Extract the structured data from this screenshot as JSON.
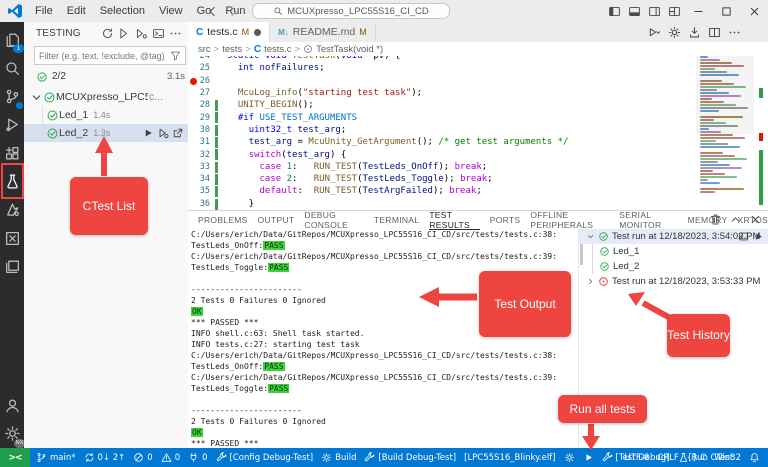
{
  "colors": {
    "status_bar": "#0078d4",
    "remote_green": "#1f9e4e",
    "pass_badge": "#3fd23f",
    "annotation_red": "#ee4540"
  },
  "titlebar": {
    "menus": [
      "File",
      "Edit",
      "Selection",
      "View",
      "Go",
      "Run",
      "···"
    ],
    "search_value": "MCUXpresso_LPC55S16_CI_CD",
    "layout_icons": [
      "toggle-sidebar",
      "toggle-panel",
      "toggle-secondary-sidebar",
      "customize-layout"
    ],
    "window_controls": [
      "minimize",
      "maximize",
      "close"
    ]
  },
  "activity_bar": {
    "items": [
      {
        "icon": "files",
        "badge": "1"
      },
      {
        "icon": "search"
      },
      {
        "icon": "source-control",
        "dot": true
      },
      {
        "icon": "run-debug"
      },
      {
        "icon": "extensions"
      },
      {
        "icon": "testing",
        "active": true
      },
      {
        "icon": "mcuxpresso"
      },
      {
        "icon": "x-square"
      },
      {
        "icon": "library"
      }
    ],
    "bottom_items": [
      {
        "icon": "account"
      },
      {
        "icon": "settings",
        "badge": "NX"
      }
    ]
  },
  "testing_panel": {
    "title": "TESTING",
    "toolbar_icons": [
      "refresh",
      "run-all",
      "debug-all",
      "terminal",
      "more"
    ],
    "filter_placeholder": "Filter (e.g. text, !exclude, @tag)",
    "summary_count": "2/2",
    "summary_time": "3.1s",
    "tree": [
      {
        "level": 0,
        "chevron": "down",
        "status": "pass",
        "label": "MCUXpresso_LPC55S16_CI_CD",
        "suffix": "c...",
        "selected": false,
        "actions": []
      },
      {
        "level": 1,
        "status": "pass",
        "label": "Led_1",
        "time": "1.4s",
        "selected": false,
        "actions": []
      },
      {
        "level": 1,
        "status": "pass",
        "label": "Led_2",
        "time": "1.3s",
        "selected": true,
        "actions": [
          "play",
          "debug-play",
          "goto"
        ]
      }
    ]
  },
  "editor": {
    "tabs": [
      {
        "label": "tests.c",
        "icon": "c-file",
        "git": "M",
        "dirty": true,
        "active": true
      },
      {
        "label": "README.md",
        "icon": "md-file",
        "git": "M",
        "dirty": false,
        "active": false
      }
    ],
    "breadcrumb": [
      {
        "label": "src"
      },
      {
        "label": "tests"
      },
      {
        "label": "tests.c",
        "icon": "c-file"
      },
      {
        "label": "TestTask(void *)",
        "icon": "symbol-method"
      }
    ],
    "action_icons": [
      "run-dropdown",
      "gear",
      "download",
      "split",
      "more"
    ],
    "code_lines": [
      {
        "n": 24,
        "seg": [
          [
            "kw",
            "static"
          ],
          [
            "pl",
            " "
          ],
          [
            "kw",
            "void"
          ],
          [
            "pl",
            " "
          ],
          [
            "fn",
            "TestTask"
          ],
          [
            "pl",
            "("
          ],
          [
            "kw",
            "void"
          ],
          [
            "pl",
            " *pv) {"
          ]
        ]
      },
      {
        "n": 25,
        "seg": [
          [
            "pl",
            "  "
          ],
          [
            "kw",
            "int"
          ],
          [
            "pl",
            " "
          ],
          [
            "var",
            "nofFailures"
          ],
          [
            "pl",
            ";"
          ]
        ]
      },
      {
        "n": 26,
        "breakpoint": true,
        "seg": []
      },
      {
        "n": 27,
        "seg": [
          [
            "pl",
            "  "
          ],
          [
            "fn",
            "McuLog_info"
          ],
          [
            "pl",
            "("
          ],
          [
            "str",
            "\"starting test task\""
          ],
          [
            "pl",
            ");"
          ]
        ]
      },
      {
        "n": 28,
        "changed": true,
        "seg": [
          [
            "pl",
            "  "
          ],
          [
            "fn",
            "UNITY_BEGIN"
          ],
          [
            "pl",
            "();"
          ]
        ]
      },
      {
        "n": 29,
        "changed": true,
        "seg": [
          [
            "pl",
            "  "
          ],
          [
            "pp",
            "#if"
          ],
          [
            "pl",
            " "
          ],
          [
            "mac",
            "USE_TEST_ARGUMENTS"
          ]
        ]
      },
      {
        "n": 30,
        "changed": true,
        "seg": [
          [
            "pl",
            "    "
          ],
          [
            "kw",
            "uint32_t"
          ],
          [
            "pl",
            " "
          ],
          [
            "var",
            "test_arg"
          ],
          [
            "pl",
            ";"
          ]
        ]
      },
      {
        "n": 31,
        "changed": true,
        "seg": [
          [
            "pl",
            "    "
          ],
          [
            "var",
            "test_arg"
          ],
          [
            "pl",
            " = "
          ],
          [
            "fn",
            "McuUnity_GetArgument"
          ],
          [
            "pl",
            "(); "
          ],
          [
            "cmt",
            "/* get test arguments */"
          ]
        ]
      },
      {
        "n": 32,
        "changed": true,
        "seg": [
          [
            "pl",
            "    "
          ],
          [
            "ctl",
            "switch"
          ],
          [
            "pl",
            "("
          ],
          [
            "var",
            "test_arg"
          ],
          [
            "pl",
            ") {"
          ]
        ]
      },
      {
        "n": 33,
        "changed": true,
        "seg": [
          [
            "pl",
            "      "
          ],
          [
            "ctl",
            "case"
          ],
          [
            "pl",
            " "
          ],
          [
            "num",
            "1"
          ],
          [
            "pl",
            ":   "
          ],
          [
            "fn",
            "RUN_TEST"
          ],
          [
            "pl",
            "("
          ],
          [
            "var",
            "TestLeds_OnOff"
          ],
          [
            "pl",
            "); "
          ],
          [
            "ctl",
            "break"
          ],
          [
            "pl",
            ";"
          ]
        ]
      },
      {
        "n": 34,
        "changed": true,
        "seg": [
          [
            "pl",
            "      "
          ],
          [
            "ctl",
            "case"
          ],
          [
            "pl",
            " "
          ],
          [
            "num",
            "2"
          ],
          [
            "pl",
            ":   "
          ],
          [
            "fn",
            "RUN_TEST"
          ],
          [
            "pl",
            "("
          ],
          [
            "var",
            "TestLeds_Toggle"
          ],
          [
            "pl",
            "); "
          ],
          [
            "ctl",
            "break"
          ],
          [
            "pl",
            ";"
          ]
        ]
      },
      {
        "n": 35,
        "changed": true,
        "seg": [
          [
            "pl",
            "      "
          ],
          [
            "ctl",
            "default"
          ],
          [
            "pl",
            ":  "
          ],
          [
            "fn",
            "RUN_TEST"
          ],
          [
            "pl",
            "("
          ],
          [
            "var",
            "TestArgFailed"
          ],
          [
            "pl",
            "); "
          ],
          [
            "ctl",
            "break"
          ],
          [
            "pl",
            ";"
          ]
        ]
      },
      {
        "n": 36,
        "changed": true,
        "seg": [
          [
            "pl",
            "    }"
          ]
        ]
      }
    ]
  },
  "panel": {
    "tabs": [
      {
        "label": "PROBLEMS"
      },
      {
        "label": "OUTPUT"
      },
      {
        "label": "DEBUG CONSOLE"
      },
      {
        "label": "TERMINAL"
      },
      {
        "label": "TEST RESULTS",
        "active": true
      },
      {
        "label": "PORTS"
      },
      {
        "label": "OFFLINE PERIPHERALS"
      },
      {
        "label": "SERIAL MONITOR"
      },
      {
        "label": "MEMORY"
      },
      {
        "label": "XRTOS"
      }
    ],
    "toolbar_icons": [
      "trash",
      "chevron-up",
      "close"
    ],
    "output_lines": [
      {
        "text": "C:/Users/erich/Data/GitRepos/MCUXpresso_LPC55S16_CI_CD/src/tests/tests.c:38:"
      },
      {
        "text": "TestLeds_OnOff:",
        "badge": "PASS"
      },
      {
        "text": "C:/Users/erich/Data/GitRepos/MCUXpresso_LPC55S16_CI_CD/src/tests/tests.c:39:"
      },
      {
        "text": "TestLeds_Toggle:",
        "badge": "PASS"
      },
      {
        "text": ""
      },
      {
        "text": "-----------------------"
      },
      {
        "text": "2 Tests 0 Failures 0 Ignored"
      },
      {
        "text": "",
        "badge": "OK"
      },
      {
        "text": "*** PASSED ***"
      },
      {
        "text": "INFO  shell.c:63: Shell task started."
      },
      {
        "text": "INFO  tests.c:27: starting test task"
      },
      {
        "text": "C:/Users/erich/Data/GitRepos/MCUXpresso_LPC55S16_CI_CD/src/tests/tests.c:38:"
      },
      {
        "text": "TestLeds_OnOff:",
        "badge": "PASS"
      },
      {
        "text": "C:/Users/erich/Data/GitRepos/MCUXpresso_LPC55S16_CI_CD/src/tests/tests.c:39:"
      },
      {
        "text": "TestLeds_Toggle:",
        "badge": "PASS"
      },
      {
        "text": ""
      },
      {
        "text": "-----------------------"
      },
      {
        "text": "2 Tests 0 Failures 0 Ignored"
      },
      {
        "text": "",
        "badge": "OK"
      },
      {
        "text": "*** PASSED ***"
      }
    ],
    "history_runs": [
      {
        "chevron": "down",
        "status": "pass",
        "label": "Test run at 12/18/2023, 3:54:02 PM",
        "selected": true,
        "actions": [
          "terminal",
          "play"
        ],
        "children": [
          {
            "status": "pass",
            "label": "Led_1"
          },
          {
            "status": "pass",
            "label": "Led_2"
          }
        ]
      },
      {
        "chevron": "right",
        "status": "fail",
        "label": "Test run at 12/18/2023, 3:53:33 PM",
        "selected": false,
        "actions": [],
        "children": []
      }
    ]
  },
  "status_bar": {
    "remote_glyph": "><",
    "left": [
      {
        "icon": "branch",
        "text": "main*"
      },
      {
        "icon": "sync",
        "text": "0↓ 2↑"
      },
      {
        "icon": "error",
        "text": "0"
      },
      {
        "icon": "warning",
        "text": "0"
      },
      {
        "icon": "plug",
        "text": "0"
      },
      {
        "icon": "tools",
        "text": "[Config Debug-Test]"
      },
      {
        "icon": "gear",
        "text": "Build"
      },
      {
        "icon": "tools",
        "text": "[Build Debug-Test]"
      },
      {
        "text": "[LPC55S16_Blinky.elf]"
      },
      {
        "icon": "gear"
      },
      {
        "icon": "play"
      },
      {
        "icon": "tools",
        "text": "[Test Debug]"
      },
      {
        "icon": "beaker",
        "text": "Run CTest"
      }
    ],
    "right": [
      {
        "text": "UTF-8"
      },
      {
        "text": "CRLF"
      },
      {
        "text": "{} C"
      },
      {
        "text": "Win32"
      },
      {
        "icon": "bell"
      }
    ]
  },
  "annotations": {
    "ctest_list": "CTest List",
    "test_output": "Test Output",
    "test_history": "Test History",
    "run_all_tests": "Run all tests"
  }
}
